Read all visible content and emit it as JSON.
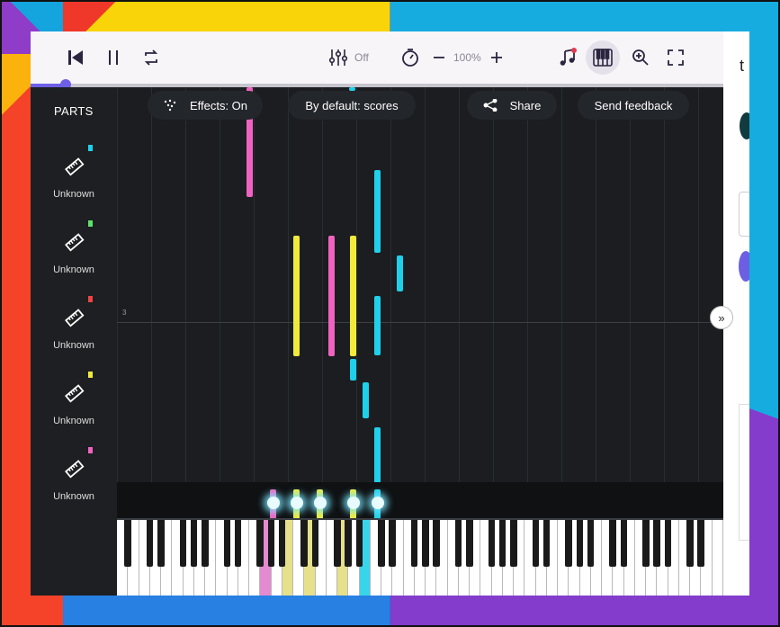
{
  "toolbar": {
    "metronome_state": "Off",
    "zoom_level": "100%",
    "icons": [
      "skip-to-start-icon",
      "pause-icon",
      "loop-icon",
      "mixer-icon",
      "timer-icon",
      "zoom-out-icon",
      "zoom-in-icon",
      "music-note-icon",
      "piano-icon",
      "magnify-icon",
      "fullscreen-icon"
    ]
  },
  "progress": {
    "value": 0.05
  },
  "roll_controls": {
    "effects": "Effects: On",
    "default_view": "By default: scores",
    "share": "Share",
    "feedback": "Send feedback"
  },
  "sidebar": {
    "title": "PARTS",
    "parts": [
      {
        "label": "Unknown",
        "color": "#1fd0ea"
      },
      {
        "label": "Unknown",
        "color": "#5be36b"
      },
      {
        "label": "Unknown",
        "color": "#ef4343"
      },
      {
        "label": "Unknown",
        "color": "#f1ea3a"
      },
      {
        "label": "Unknown",
        "color": "#f062c0"
      }
    ]
  },
  "roll": {
    "measure_number": "3",
    "colors": {
      "pink": "#f062c0",
      "yellow": "#f1ea3a",
      "cyan": "#1fd0ea"
    }
  },
  "right_panel": {
    "expand_label": "»"
  }
}
